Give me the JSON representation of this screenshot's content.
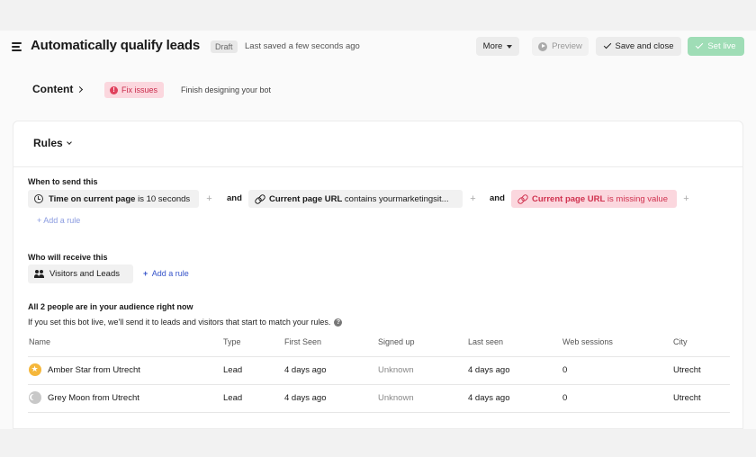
{
  "header": {
    "title": "Automatically qualify leads",
    "status_badge": "Draft",
    "saved_text": "Last saved a few seconds ago",
    "more_label": "More",
    "preview_label": "Preview",
    "save_close_label": "Save and close",
    "set_live_label": "Set live"
  },
  "content_step": {
    "label": "Content",
    "fix_issues_label": "Fix issues",
    "hint": "Finish designing your bot"
  },
  "rules": {
    "heading": "Rules",
    "when_label": "When to send this",
    "conditions": [
      {
        "attr": "Time on current page",
        "rest": " is 10 seconds",
        "icon": "clock-icon"
      },
      {
        "attr": "Current page URL",
        "rest": " contains yourmarketingsit...",
        "icon": "link-icon"
      },
      {
        "attr": "Current page URL",
        "rest": " is missing value",
        "icon": "link-icon",
        "error": true
      }
    ],
    "and_label": "and",
    "add_rule_label": "+ Add a rule",
    "who_label": "Who will receive this",
    "audience_chip": "Visitors and Leads",
    "add_rule_audience_label": "Add a rule"
  },
  "audience": {
    "title": "All 2 people are in your audience right now",
    "description": "If you set this bot live, we'll send it to leads and visitors that start to match your rules.",
    "columns": [
      "Name",
      "Type",
      "First Seen",
      "Signed up",
      "Last seen",
      "Web sessions",
      "City"
    ],
    "rows": [
      {
        "name": "Amber Star from Utrecht",
        "type": "Lead",
        "first_seen": "4 days ago",
        "signed_up": "Unknown",
        "last_seen": "4 days ago",
        "web_sessions": "0",
        "city": "Utrecht",
        "avatar": "star-avatar"
      },
      {
        "name": "Grey Moon from Utrecht",
        "type": "Lead",
        "first_seen": "4 days ago",
        "signed_up": "Unknown",
        "last_seen": "4 days ago",
        "web_sessions": "0",
        "city": "Utrecht",
        "avatar": "moon-avatar"
      }
    ]
  },
  "colors": {
    "set_live_bg": "#9fddb6",
    "error_bg": "#fbd7de",
    "error_text": "#d0324f",
    "link_blue": "#3553c9"
  }
}
